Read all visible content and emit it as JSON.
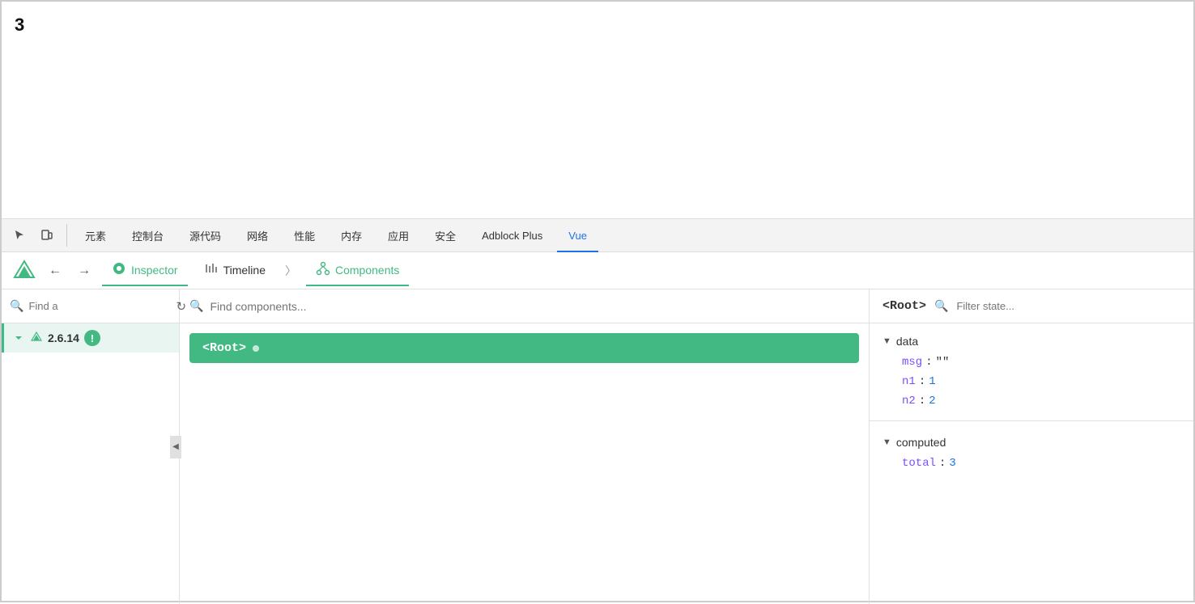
{
  "page": {
    "number": "3"
  },
  "devtools": {
    "tabs": [
      {
        "label": "元素",
        "id": "elements"
      },
      {
        "label": "控制台",
        "id": "console"
      },
      {
        "label": "源代码",
        "id": "sources"
      },
      {
        "label": "网络",
        "id": "network"
      },
      {
        "label": "性能",
        "id": "performance"
      },
      {
        "label": "内存",
        "id": "memory"
      },
      {
        "label": "应用",
        "id": "application"
      },
      {
        "label": "安全",
        "id": "security"
      },
      {
        "label": "Adblock Plus",
        "id": "adblock"
      },
      {
        "label": "Vue",
        "id": "vue",
        "active": true
      }
    ]
  },
  "vue": {
    "tabs": [
      {
        "label": "Inspector",
        "id": "inspector",
        "active": true
      },
      {
        "label": "Timeline",
        "id": "timeline"
      },
      {
        "label": "Components",
        "id": "components"
      }
    ],
    "version": "2.6.14",
    "sidebar": {
      "search_placeholder": "Find a",
      "app_version": "V 2.6.14"
    },
    "component_search_placeholder": "Find components...",
    "root_component": "<Root>",
    "state": {
      "header": "<Root>",
      "filter_placeholder": "Filter state...",
      "sections": [
        {
          "title": "data",
          "fields": [
            {
              "key": "msg",
              "value": "\"\"",
              "type": "string"
            },
            {
              "key": "n1",
              "value": "1",
              "type": "number"
            },
            {
              "key": "n2",
              "value": "2",
              "type": "number"
            }
          ]
        },
        {
          "title": "computed",
          "fields": [
            {
              "key": "total",
              "value": "3",
              "type": "number"
            }
          ]
        }
      ]
    }
  }
}
